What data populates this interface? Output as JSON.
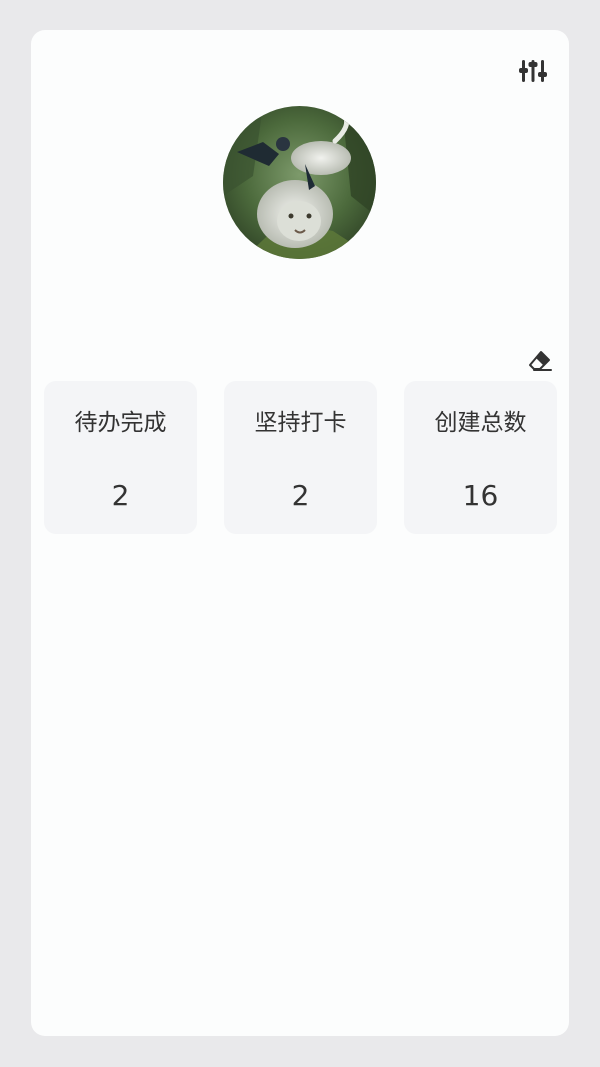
{
  "header": {
    "settings_icon": "sliders-icon"
  },
  "profile": {
    "avatar_description": "avatar image"
  },
  "toolbar": {
    "clear_icon": "eraser-icon"
  },
  "stats": [
    {
      "label": "待办完成",
      "value": "2"
    },
    {
      "label": "坚持打卡",
      "value": "2"
    },
    {
      "label": "创建总数",
      "value": "16"
    }
  ],
  "colors": {
    "background": "#e9e9eb",
    "card": "#fcfdfd",
    "stat_tile": "#f4f5f7",
    "text": "#333333"
  }
}
